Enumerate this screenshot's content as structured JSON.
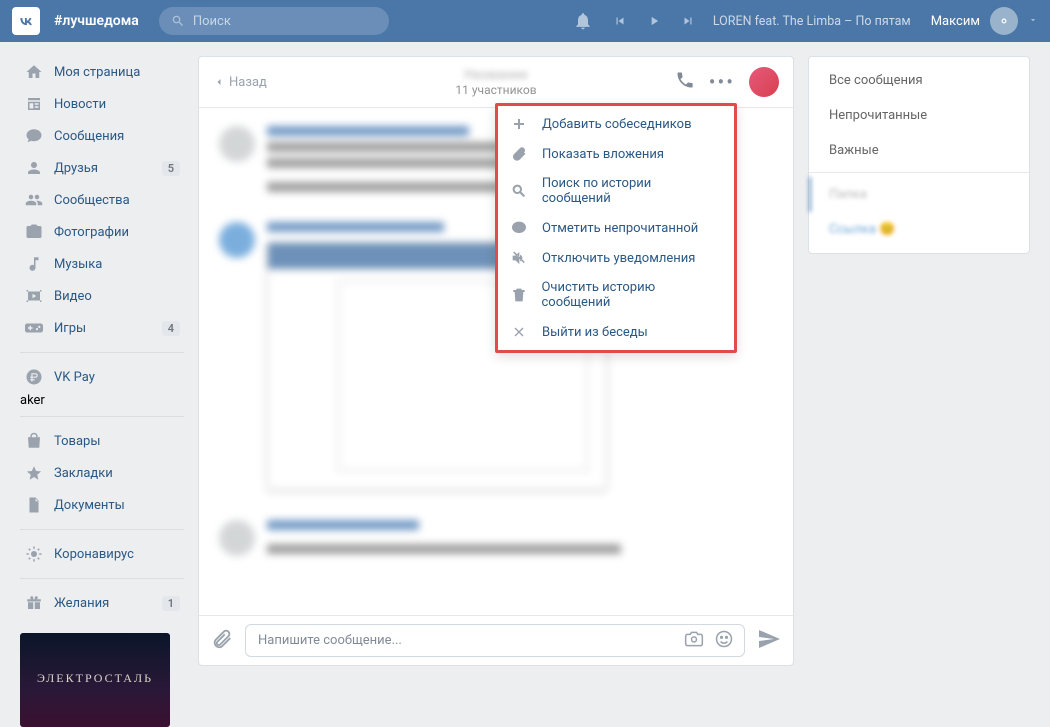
{
  "header": {
    "tag": "#лучшедома",
    "search_placeholder": "Поиск",
    "now_playing": "LOREN feat. The Limba  –  По пятам",
    "username": "Максим"
  },
  "sidebar": {
    "items": [
      {
        "label": "Моя страница",
        "icon": "home"
      },
      {
        "label": "Новости",
        "icon": "news"
      },
      {
        "label": "Сообщения",
        "icon": "chat"
      },
      {
        "label": "Друзья",
        "icon": "user",
        "badge": "5"
      },
      {
        "label": "Сообщества",
        "icon": "users"
      },
      {
        "label": "Фотографии",
        "icon": "camera"
      },
      {
        "label": "Музыка",
        "icon": "music"
      },
      {
        "label": "Видео",
        "icon": "video"
      },
      {
        "label": "Игры",
        "icon": "gamepad",
        "badge": "4"
      }
    ],
    "items2": [
      {
        "label": "VK Pay",
        "icon": "ruble"
      }
    ],
    "items3": [
      {
        "label": "Товары",
        "icon": "bag"
      },
      {
        "label": "Закладки",
        "icon": "star"
      },
      {
        "label": "Документы",
        "icon": "doc"
      }
    ],
    "items4": [
      {
        "label": "Коронавирус",
        "icon": "virus"
      }
    ],
    "items5": [
      {
        "label": "Желания",
        "icon": "gift",
        "badge": "1"
      }
    ]
  },
  "chat": {
    "back": "Назад",
    "participants": "11 участников",
    "input_placeholder": "Напишите сообщение..."
  },
  "dropdown": {
    "items": [
      "Добавить собеседников",
      "Показать вложения",
      "Поиск по истории сообщений",
      "Отметить непрочитанной",
      "Отключить уведомления",
      "Очистить историю сообщений",
      "Выйти из беседы"
    ]
  },
  "folders": {
    "items": [
      "Все сообщения",
      "Непрочитанные",
      "Важные"
    ]
  }
}
